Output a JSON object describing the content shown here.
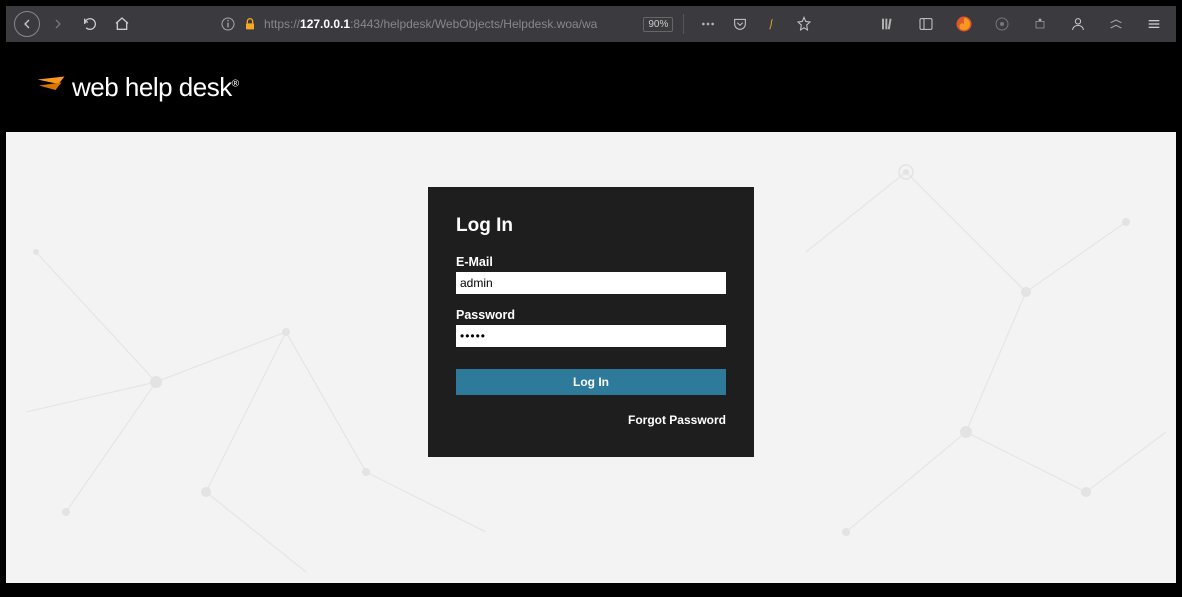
{
  "browser": {
    "url_prefix": "https://",
    "url_host": "127.0.0.1",
    "url_port": ":8443",
    "url_path": "/helpdesk/WebObjects/Helpdesk.woa/wa",
    "zoom": "90%"
  },
  "header": {
    "brand": "web help desk"
  },
  "login": {
    "title": "Log In",
    "email_label": "E-Mail",
    "email_value": "admin",
    "password_label": "Password",
    "password_value": "•••••",
    "submit_label": "Log In",
    "forgot_label": "Forgot Password"
  },
  "colors": {
    "accent_orange": "#f8991d",
    "button_blue": "#2d7a9a",
    "panel_bg": "#1e1e1e"
  }
}
